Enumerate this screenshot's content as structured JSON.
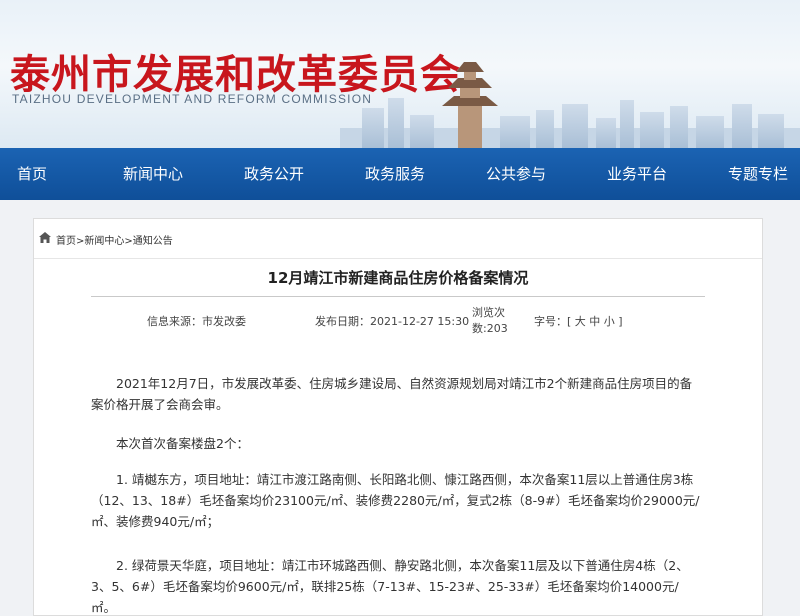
{
  "header": {
    "title_cn": "泰州市发展和改革委员会",
    "title_en": "TAIZHOU DEVELOPMENT AND REFORM COMMISSION"
  },
  "nav": {
    "items": [
      "首页",
      "新闻中心",
      "政务公开",
      "政务服务",
      "公共参与",
      "业务平台",
      "专题专栏"
    ]
  },
  "breadcrumb": {
    "home": "首页",
    "sep": ">",
    "news": "新闻中心",
    "notice": "通知公告"
  },
  "article": {
    "title": "12月靖江市新建商品住房价格备案情况",
    "source_label": "信息来源：市发改委",
    "date_label": "发布日期：2021-12-27 15:30",
    "views_label": "浏览次数:203",
    "font_size_label": "字号：[ 大 中 小 ]",
    "paragraphs": [
      "2021年12月7日，市发展改革委、住房城乡建设局、自然资源规划局对靖江市2个新建商品住房项目的备案价格开展了会商会审。",
      "本次首次备案楼盘2个：",
      "1. 靖樾东方，项目地址：靖江市渡江路南侧、长阳路北侧、慷江路西侧，本次备案11层以上普通住房3栋（12、13、18#）毛坯备案均价23100元/㎡、装修费2280元/㎡，复式2栋（8-9#）毛坯备案均价29000元/㎡、装修费940元/㎡；",
      "2. 绿荷景天华庭，项目地址：靖江市环城路西侧、静安路北侧，本次备案11层及以下普通住房4栋（2、3、5、6#）毛坯备案均价9600元/㎡，联排25栋（7-13#、15-23#、25-33#）毛坯备案均价14000元/㎡。"
    ]
  },
  "colors": {
    "brand_red": "#c8161d",
    "nav_blue": "#1659a8"
  }
}
